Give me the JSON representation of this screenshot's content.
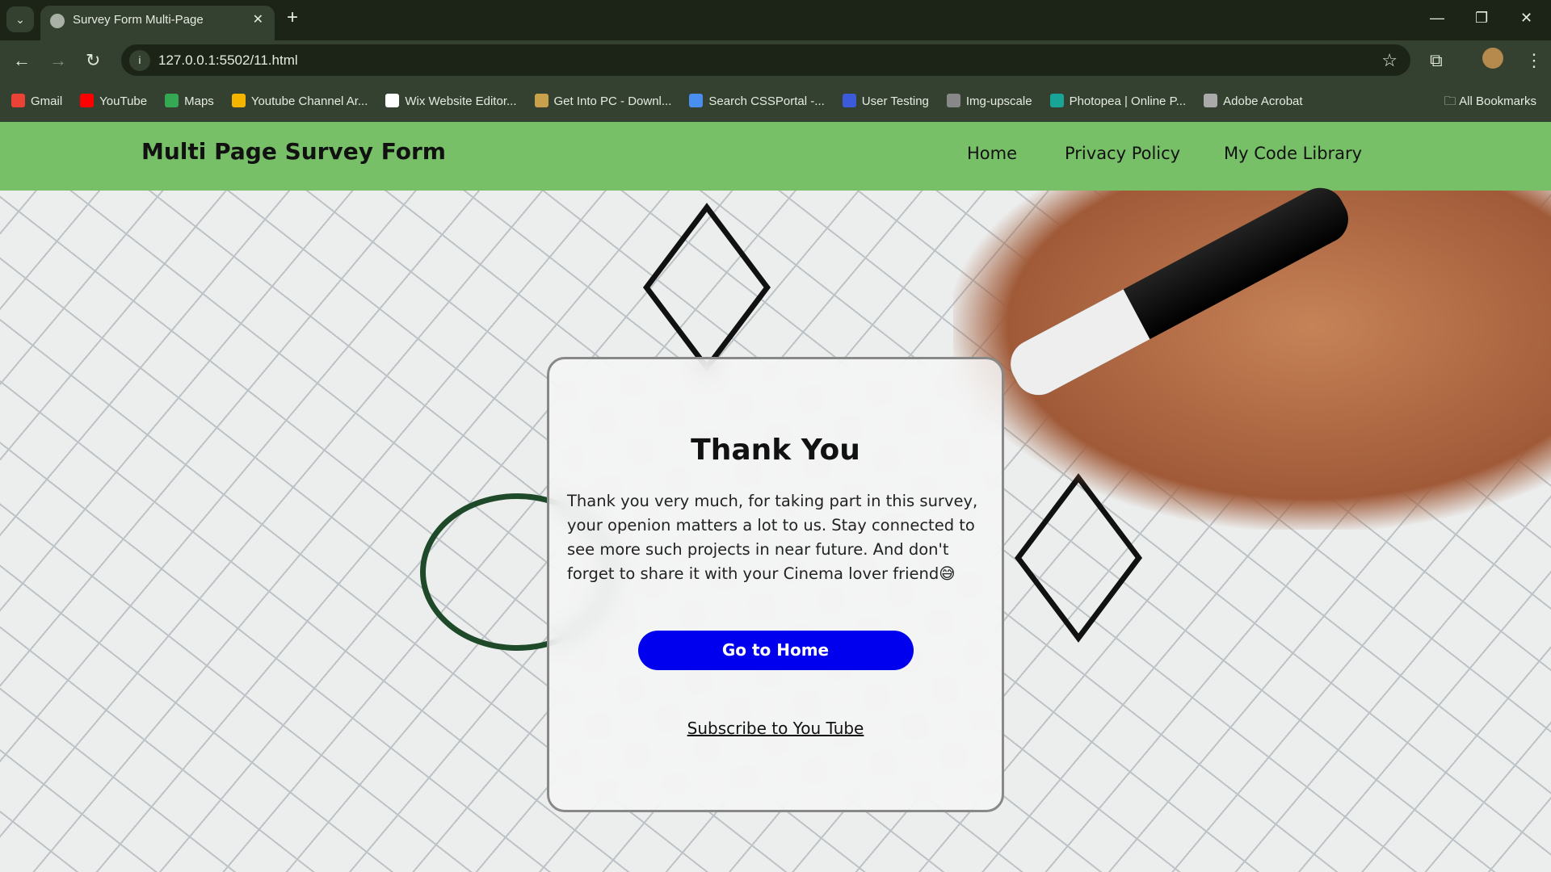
{
  "browser": {
    "tab_title": "Survey Form Multi-Page",
    "url": "127.0.0.1:5502/11.html",
    "bookmarks": [
      {
        "label": "Gmail",
        "color": "#ea4335"
      },
      {
        "label": "YouTube",
        "color": "#ff0000"
      },
      {
        "label": "Maps",
        "color": "#34a853"
      },
      {
        "label": "Youtube Channel Ar...",
        "color": "#f4b400"
      },
      {
        "label": "Wix Website Editor...",
        "color": "#ffffff"
      },
      {
        "label": "Get Into PC - Downl...",
        "color": "#c9a04b"
      },
      {
        "label": "Search CSSPortal -...",
        "color": "#4a8ff0"
      },
      {
        "label": "User Testing",
        "color": "#3b5bdb"
      },
      {
        "label": "Img-upscale",
        "color": "#888888"
      },
      {
        "label": "Photopea | Online P...",
        "color": "#18a497"
      },
      {
        "label": "Adobe Acrobat",
        "color": "#aaaaaa"
      }
    ],
    "all_bookmarks": "All Bookmarks"
  },
  "header": {
    "brand": "Multi Page Survey Form",
    "nav": [
      "Home",
      "Privacy Policy",
      "My Code Library"
    ],
    "background": "#77c067"
  },
  "card": {
    "title": "Thank You",
    "message": "Thank you very much, for taking part in this survey, your openion matters a lot to us. Stay connected to see more such projects in near future. And don't forget to share it with your Cinema lover friend😅",
    "button": "Go to Home",
    "button_color": "#0000ee",
    "link": "Subscribe to You Tube"
  }
}
